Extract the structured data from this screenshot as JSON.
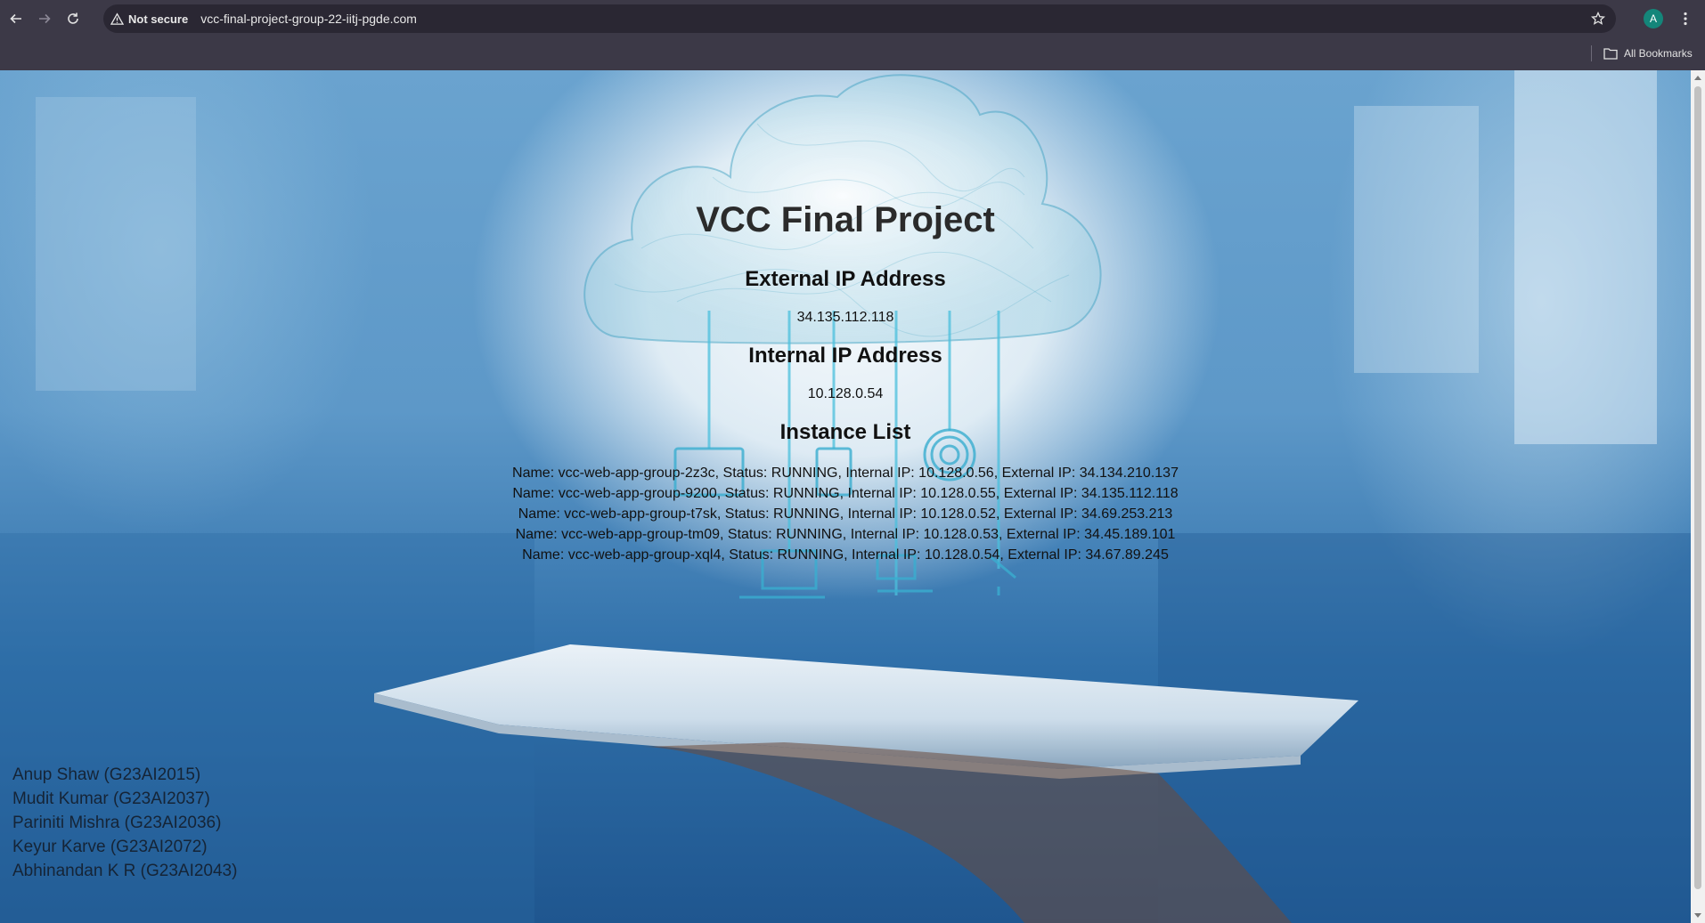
{
  "browser": {
    "security_label": "Not secure",
    "url": "vcc-final-project-group-22-iitj-pgde.com",
    "avatar_letter": "A",
    "all_bookmarks_label": "All Bookmarks"
  },
  "page": {
    "title": "VCC Final Project",
    "external_ip": {
      "heading": "External IP Address",
      "value": "34.135.112.118"
    },
    "internal_ip": {
      "heading": "Internal IP Address",
      "value": "10.128.0.54"
    },
    "instance_list": {
      "heading": "Instance List",
      "items": [
        "Name: vcc-web-app-group-2z3c, Status: RUNNING, Internal IP: 10.128.0.56, External IP: 34.134.210.137",
        "Name: vcc-web-app-group-9200, Status: RUNNING, Internal IP: 10.128.0.55, External IP: 34.135.112.118",
        "Name: vcc-web-app-group-t7sk, Status: RUNNING, Internal IP: 10.128.0.52, External IP: 34.69.253.213",
        "Name: vcc-web-app-group-tm09, Status: RUNNING, Internal IP: 10.128.0.53, External IP: 34.45.189.101",
        "Name: vcc-web-app-group-xql4, Status: RUNNING, Internal IP: 10.128.0.54, External IP: 34.67.89.245"
      ]
    },
    "members": [
      "Anup Shaw (G23AI2015)",
      "Mudit Kumar (G23AI2037)",
      "Pariniti Mishra (G23AI2036)",
      "Keyur Karve (G23AI2072)",
      "Abhinandan K R (G23AI2043)"
    ]
  },
  "colors": {
    "chrome_bg": "#3c3947",
    "omnibox_bg": "#2a2733",
    "avatar_bg": "#14867a",
    "cloud_teal": "#3b9fbf"
  },
  "icons": [
    "back-arrow-icon",
    "forward-arrow-icon",
    "reload-icon",
    "warning-icon",
    "star-icon",
    "kebab-menu-icon",
    "folder-icon"
  ]
}
